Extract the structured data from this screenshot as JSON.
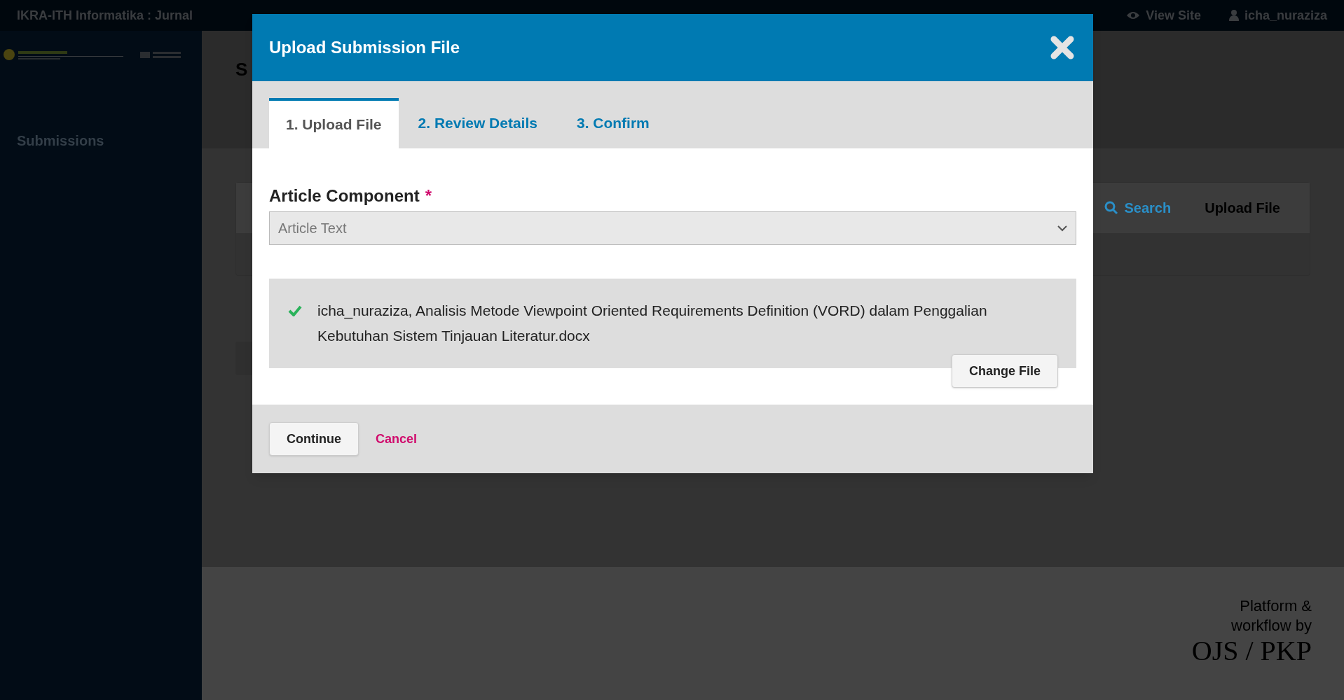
{
  "top_bar": {
    "journal_title": "IKRA-ITH Informatika : Jurnal",
    "view_site": "View Site",
    "user": "icha_nuraziza"
  },
  "sidebar": {
    "items": [
      {
        "label": "Submissions"
      }
    ]
  },
  "page": {
    "title": "S",
    "toolbar": [
      {
        "kind": "search",
        "label": "Search"
      },
      {
        "kind": "plain",
        "label": "Upload File"
      }
    ]
  },
  "footer": {
    "lines": [
      "Platform &",
      "workflow by"
    ],
    "brand": "OJS / PKP"
  },
  "dialog": {
    "title": "Upload Submission File",
    "tabs": [
      {
        "label": "1. Upload File",
        "selected": true
      },
      {
        "label": "2. Review Details",
        "selected": false
      },
      {
        "label": "3. Confirm",
        "selected": false
      }
    ],
    "field": {
      "label": "Article Component",
      "required_mark": "*",
      "value": "Article Text"
    },
    "file": {
      "uploaded": true,
      "name": "icha_nuraziza, Analisis Metode Viewpoint Oriented Requirements Definition (VORD) dalam Penggalian Kebutuhan Sistem Tinjauan Literatur.docx"
    },
    "change_button": "Change File",
    "buttons": [
      {
        "kind": "primary",
        "label": "Continue"
      },
      {
        "kind": "link",
        "label": "Cancel"
      }
    ]
  }
}
